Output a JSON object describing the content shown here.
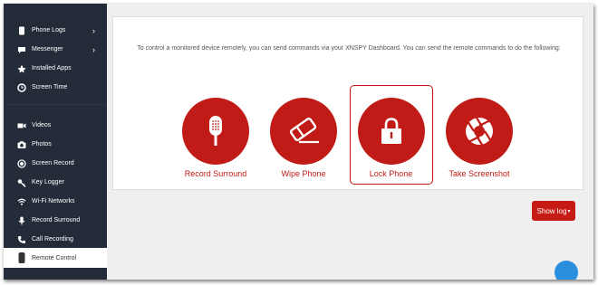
{
  "sidebar": {
    "items": [
      {
        "label": "Phone Logs",
        "icon": "phone-icon",
        "chevron": "›"
      },
      {
        "label": "Messenger",
        "icon": "chat-icon",
        "chevron": "›"
      },
      {
        "label": "Installed Apps",
        "icon": "apps-icon"
      },
      {
        "label": "Screen Time",
        "icon": "clock-icon"
      },
      {
        "label": "Videos",
        "icon": "video-icon"
      },
      {
        "label": "Photos",
        "icon": "camera-icon"
      },
      {
        "label": "Screen Record",
        "icon": "record-icon"
      },
      {
        "label": "Key Logger",
        "icon": "key-icon"
      },
      {
        "label": "Wi-Fi Networks",
        "icon": "wifi-icon"
      },
      {
        "label": "Record Surround",
        "icon": "microphone-icon"
      },
      {
        "label": "Call Recording",
        "icon": "phone-icon"
      },
      {
        "label": "Remote Control",
        "icon": "remote-icon",
        "active": true
      }
    ]
  },
  "main": {
    "intro": "To control a monitored device remotely, you can send commands via your XNSPY Dashboard. You can send the remote commands to do the following:",
    "commands": [
      {
        "label": "Record Surround",
        "icon": "microphone-icon"
      },
      {
        "label": "Wipe Phone",
        "icon": "eraser-icon"
      },
      {
        "label": "Lock Phone",
        "icon": "lock-icon",
        "selected": true
      },
      {
        "label": "Take Screenshot",
        "icon": "aperture-icon"
      }
    ],
    "show_log_label": "Show log",
    "show_log_caret": "▾"
  },
  "colors": {
    "accent": "#c11b17",
    "sidebar_bg": "#242c3a",
    "fab": "#2b8fe0"
  }
}
